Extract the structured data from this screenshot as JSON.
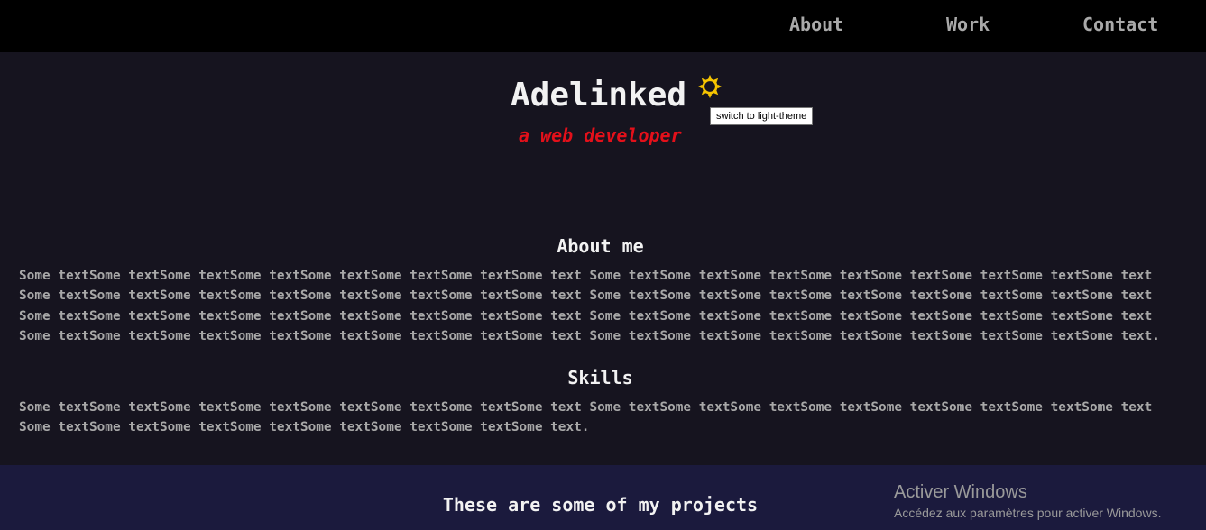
{
  "nav": {
    "items": [
      {
        "label": "About"
      },
      {
        "label": "Work"
      },
      {
        "label": "Contact"
      }
    ]
  },
  "hero": {
    "title": "Adelinked",
    "subtitle": "a web developer",
    "theme_toggle_icon": "sun-icon",
    "theme_toggle_tooltip": "switch to light-theme"
  },
  "about": {
    "heading": "About me",
    "lines": [
      "Some textSome textSome textSome textSome textSome textSome textSome text Some textSome textSome textSome textSome textSome textSome textSome text",
      "Some textSome textSome textSome textSome textSome textSome textSome text Some textSome textSome textSome textSome textSome textSome textSome text",
      "Some textSome textSome textSome textSome textSome textSome textSome text Some textSome textSome textSome textSome textSome textSome textSome text",
      "Some textSome textSome textSome textSome textSome textSome textSome text Some textSome textSome textSome textSome textSome textSome textSome text."
    ]
  },
  "skills": {
    "heading": "Skills",
    "lines": [
      "Some textSome textSome textSome textSome textSome textSome textSome text Some textSome textSome textSome textSome textSome textSome textSome text",
      "Some textSome textSome textSome textSome textSome textSome textSome text."
    ]
  },
  "projects": {
    "heading": "These are some of my projects"
  },
  "watermark": {
    "title": "Activer Windows",
    "subtitle": "Accédez aux paramètres pour activer Windows."
  },
  "colors": {
    "nav_bg": "#000000",
    "page_bg": "#16141f",
    "projects_bg": "#1b1a3d",
    "accent_red": "#e3101a",
    "sun_yellow": "#f5c400"
  }
}
